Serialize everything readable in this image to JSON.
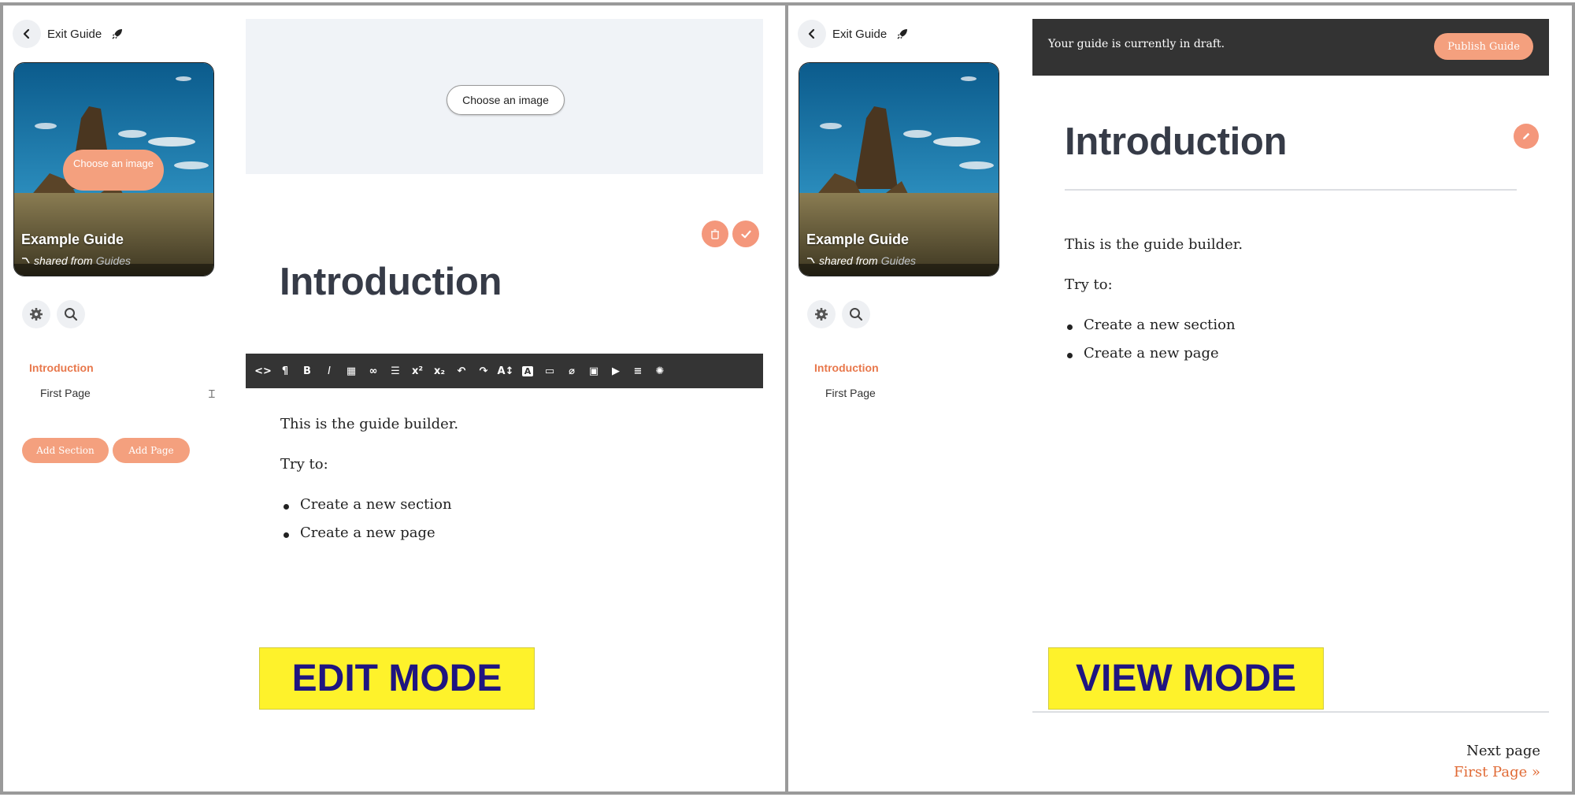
{
  "sidebar": {
    "exit_label": "Exit Guide",
    "guide_title": "Example Guide",
    "shared_prefix": "shared from",
    "shared_source": "Guides",
    "choose_image": "Choose an image",
    "nav": {
      "section": "Introduction",
      "page": "First Page"
    },
    "add_section": "Add Section",
    "add_page": "Add Page"
  },
  "edit": {
    "choose_image": "Choose an image",
    "heading": "Introduction",
    "mode_label": "EDIT MODE",
    "toolbar": [
      "code",
      "paragraph",
      "bold",
      "italic",
      "table",
      "link",
      "list",
      "superscript",
      "subscript",
      "undo",
      "redo",
      "text-size",
      "text-color",
      "embed",
      "attachment",
      "image",
      "video",
      "align",
      "settings"
    ]
  },
  "content": {
    "line1": "This is the guide builder.",
    "line2": "Try to:",
    "bullets": [
      "Create a new section",
      "Create a new page"
    ]
  },
  "view": {
    "draft_text": "Your guide is currently in draft.",
    "publish": "Publish Guide",
    "heading": "Introduction",
    "mode_label": "VIEW MODE",
    "next_label": "Next page",
    "next_link": "First Page »"
  },
  "colors": {
    "accent": "#f4a07e",
    "section": "#e8784c",
    "highlight": "#fef22b",
    "label_text": "#1f1580"
  }
}
